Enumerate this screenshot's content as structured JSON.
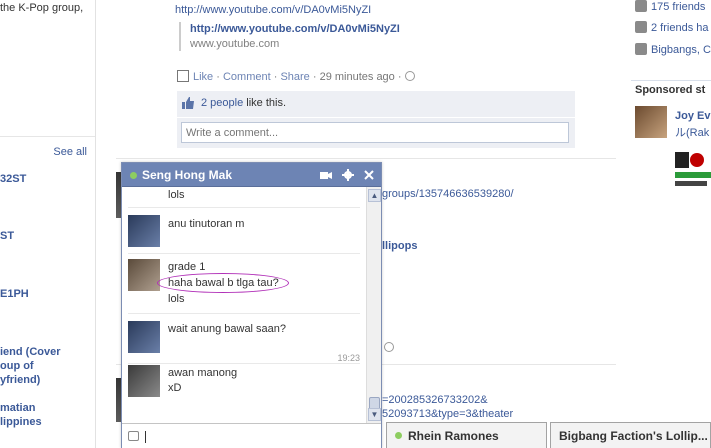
{
  "left_col": {
    "intro": "the K-Pop group,",
    "see_all": "See all",
    "fragments": [
      "32ST",
      "ST",
      "E1PH"
    ],
    "fragment_multi_1": [
      "iend (Cover",
      "oup of",
      "yfriend)"
    ],
    "fragment_multi_2": [
      "matian",
      "lippines"
    ]
  },
  "feed": {
    "post_url": "http://www.youtube.com/v/DA0vMi5NyZI",
    "attachment_title": "http://www.youtube.com/v/DA0vMi5NyZI",
    "attachment_domain": "www.youtube.com",
    "actions": {
      "like": "Like",
      "comment": "Comment",
      "share": "Share",
      "sep": " · ",
      "time": "29 minutes ago",
      "globe": " · "
    },
    "likes": {
      "count_text": "2 people",
      "suffix": " like this."
    },
    "comment_placeholder": "Write a comment...",
    "fragments": {
      "groups_url": "groups/135746636539280/",
      "llipops": "llipops",
      "bottom_url_1": "=200285326733202&",
      "bottom_url_2": "52093713&type=3&theater"
    }
  },
  "right_col": {
    "friends": "175 friends",
    "friends2": "2 friends ha",
    "bigbang": "Bigbangs, C",
    "sponsored": "Sponsored st",
    "sp_name": "Joy Ev",
    "sp_sub": "ル(Rak"
  },
  "chat": {
    "title": "Seng Hong Mak",
    "messages": [
      {
        "lines": [
          "lols"
        ]
      },
      {
        "lines": [
          "anu tinutoran m"
        ]
      },
      {
        "lines": [
          "grade 1",
          "haha bawal b tlga tau?",
          "lols"
        ]
      },
      {
        "lines": [
          "wait anung bawal saan?"
        ]
      },
      {
        "time": "19:23",
        "lines": [
          "awan manong",
          "xD"
        ]
      }
    ],
    "colors": {
      "titlebar": "#6d84b4",
      "online": "#8dcd60",
      "highlight_ellipse": "#b130b8"
    }
  },
  "dock": {
    "tab1": "Rhein Ramones",
    "tab2": "Bigbang Faction's Lollip..."
  }
}
